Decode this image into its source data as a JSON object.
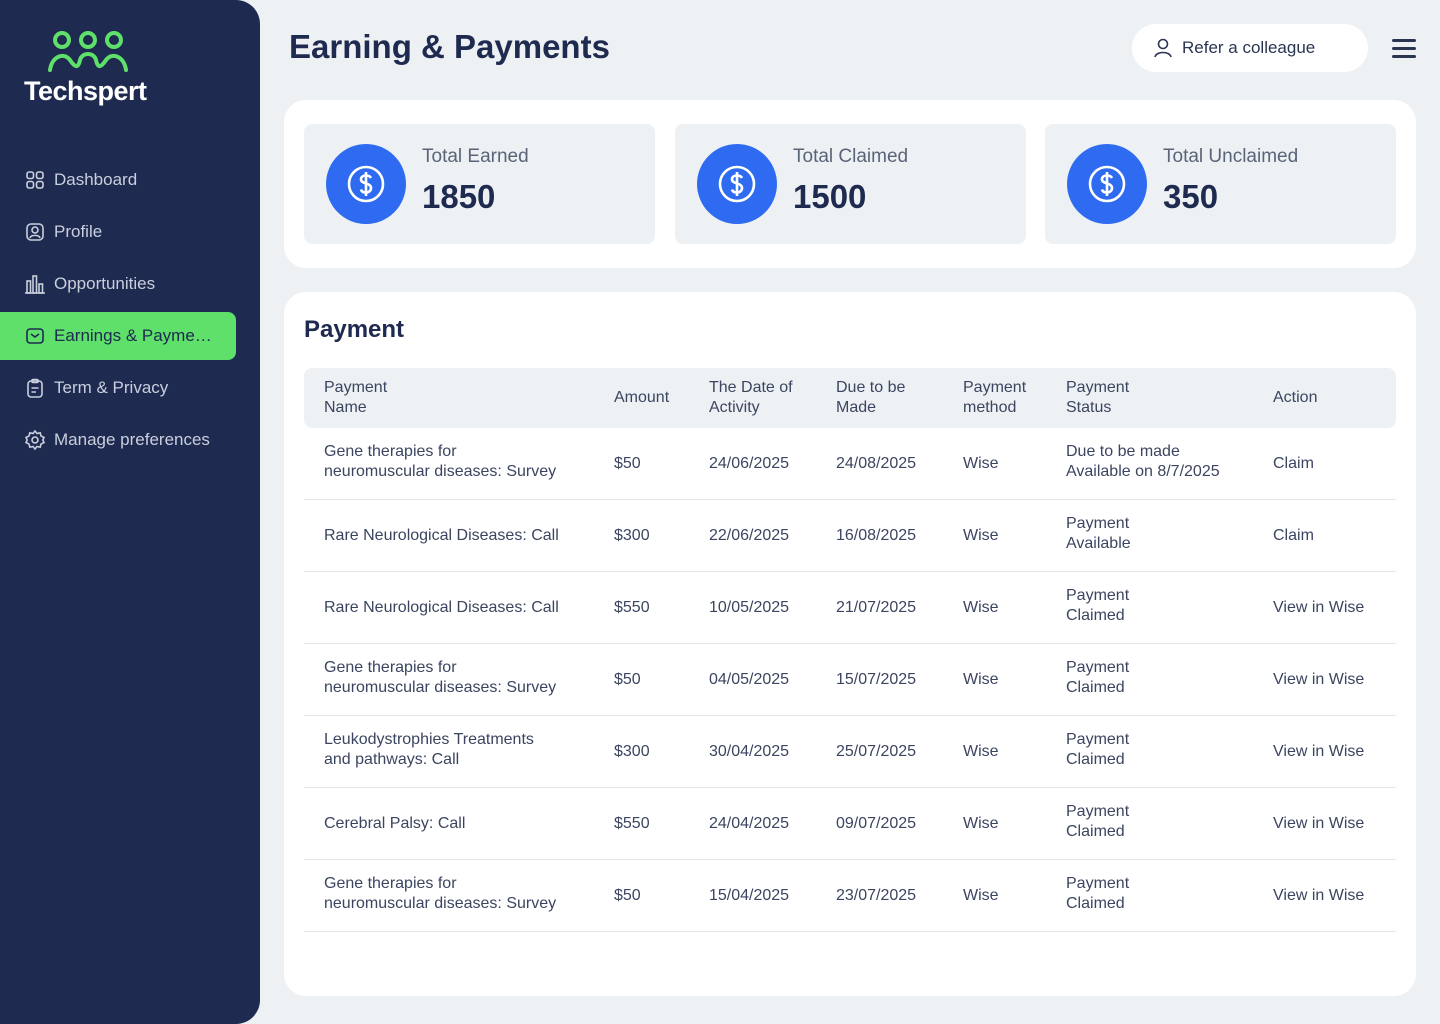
{
  "brand": {
    "name": "Techspert",
    "accent": "#5ee06a",
    "sidebar_bg": "#1e2a4f",
    "primary_blue": "#2f6bf0"
  },
  "sidebar": {
    "items": [
      {
        "label": "Dashboard",
        "icon": "grid-icon"
      },
      {
        "label": "Profile",
        "icon": "user-square-icon"
      },
      {
        "label": "Opportunities",
        "icon": "bar-chart-icon"
      },
      {
        "label": "Earnings & Payments",
        "icon": "mail-icon",
        "active": true
      },
      {
        "label": "Term & Privacy",
        "icon": "clipboard-icon"
      },
      {
        "label": "Manage preferences",
        "icon": "gear-icon"
      }
    ]
  },
  "header": {
    "title": "Earning & Payments",
    "refer_label": "Refer a colleague"
  },
  "summary": [
    {
      "label": "Total Earned",
      "value": "1850",
      "icon": "dollar-icon"
    },
    {
      "label": "Total Claimed",
      "value": "1500",
      "icon": "dollar-icon"
    },
    {
      "label": "Total Unclaimed",
      "value": "350",
      "icon": "dollar-icon"
    }
  ],
  "payments": {
    "title": "Payment",
    "columns": [
      [
        "Payment",
        "Name"
      ],
      [
        "Amount"
      ],
      [
        "The Date of",
        "Activity"
      ],
      [
        "Due to be",
        "Made"
      ],
      [
        "Payment",
        "method"
      ],
      [
        "Payment",
        "Status"
      ],
      [
        "Action"
      ]
    ],
    "rows": [
      {
        "name": [
          "Gene therapies for",
          "neuromuscular diseases: Survey"
        ],
        "amount": "$50",
        "activity": "24/06/2025",
        "due": "24/08/2025",
        "method": "Wise",
        "status": [
          "Due to be made",
          "Available on 8/7/2025"
        ],
        "action": "Claim"
      },
      {
        "name": [
          "Rare Neurological Diseases: Call"
        ],
        "amount": "$300",
        "activity": "22/06/2025",
        "due": "16/08/2025",
        "method": "Wise",
        "status": [
          "Payment",
          "Available"
        ],
        "action": "Claim"
      },
      {
        "name": [
          "Rare Neurological Diseases: Call"
        ],
        "amount": "$550",
        "activity": "10/05/2025",
        "due": "21/07/2025",
        "method": "Wise",
        "status": [
          "Payment",
          "Claimed"
        ],
        "action": "View in Wise"
      },
      {
        "name": [
          "Gene therapies for",
          "neuromuscular diseases: Survey"
        ],
        "amount": "$50",
        "activity": "04/05/2025",
        "due": "15/07/2025",
        "method": "Wise",
        "status": [
          "Payment",
          "Claimed"
        ],
        "action": "View in Wise"
      },
      {
        "name": [
          "Leukodystrophies Treatments",
          "and pathways: Call"
        ],
        "amount": "$300",
        "activity": "30/04/2025",
        "due": "25/07/2025",
        "method": "Wise",
        "status": [
          "Payment",
          "Claimed"
        ],
        "action": "View in Wise"
      },
      {
        "name": [
          "Cerebral Palsy: Call"
        ],
        "amount": "$550",
        "activity": "24/04/2025",
        "due": "09/07/2025",
        "method": "Wise",
        "status": [
          "Payment",
          "Claimed"
        ],
        "action": "View in Wise"
      },
      {
        "name": [
          "Gene therapies for",
          "neuromuscular diseases: Survey"
        ],
        "amount": "$50",
        "activity": "15/04/2025",
        "due": "23/07/2025",
        "method": "Wise",
        "status": [
          "Payment",
          "Claimed"
        ],
        "action": "View in Wise"
      }
    ]
  }
}
